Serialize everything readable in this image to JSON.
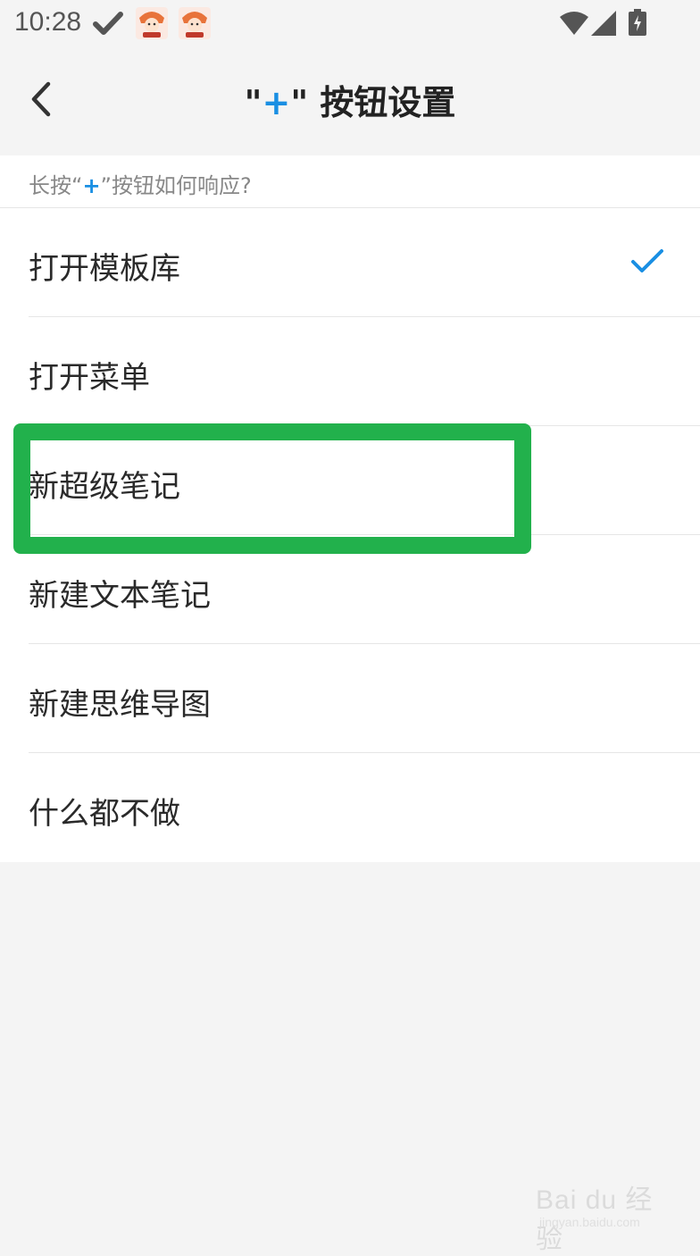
{
  "status_bar": {
    "time": "10:28",
    "icons": [
      "check-icon",
      "app-avatar-icon",
      "app-avatar-icon",
      "wifi-icon",
      "cell-signal-icon",
      "battery-charging-icon"
    ]
  },
  "header": {
    "title_prefix": "\"",
    "title_plus": "+",
    "title_suffix": "\" 按钮设置",
    "back_icon": "chevron-left-icon"
  },
  "section": {
    "label_prefix": "长按“",
    "label_plus": "+",
    "label_suffix": "”按钮如何响应?"
  },
  "options": [
    {
      "label": "打开模板库",
      "selected": true
    },
    {
      "label": "打开菜单",
      "selected": false
    },
    {
      "label": "新超级笔记",
      "selected": false
    },
    {
      "label": "新建文本笔记",
      "selected": false
    },
    {
      "label": "新建思维导图",
      "selected": false
    },
    {
      "label": "什么都不做",
      "selected": false
    }
  ],
  "colors": {
    "accent": "#1a8fe3",
    "highlight": "#22b14c",
    "background": "#f4f4f4"
  },
  "watermark": {
    "text": "Bai du 经验",
    "sub": "jingyan.baidu.com"
  }
}
